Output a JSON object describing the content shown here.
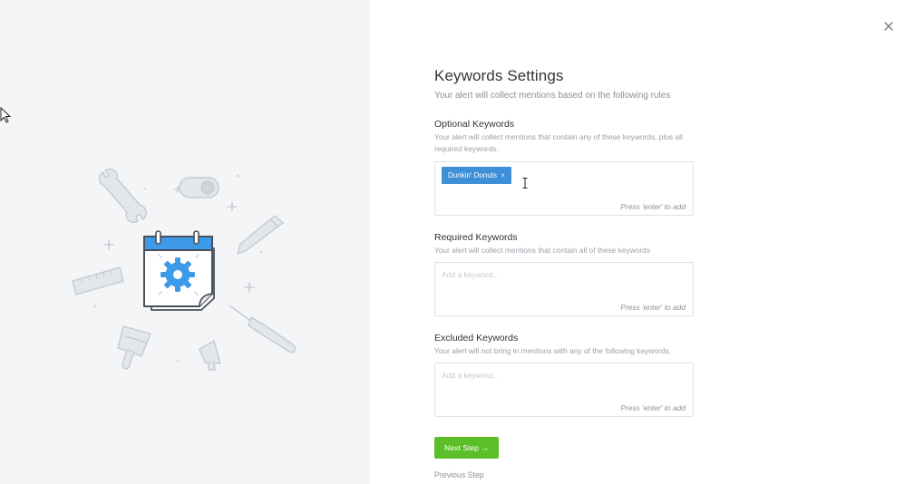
{
  "illustration": {
    "icons": [
      "calendar-gear-icon",
      "wrench-icon",
      "toggle-icon",
      "pencil-icon",
      "ruler-icon",
      "screwdriver-icon",
      "paintbrush-icon",
      "megaphone-icon"
    ],
    "accent_color": "#3d9ae8",
    "line_color": "#4a4f5c"
  },
  "dialog": {
    "close_icon": "close-icon",
    "title": "Keywords Settings",
    "subtitle": "Your alert will collect mentions based on the following rules"
  },
  "optional": {
    "title": "Optional Keywords",
    "desc": "Your alert will collect mentions that contain any of these keywords, plus all required keywords.",
    "tags": [
      {
        "label": "Dunkin' Donuts",
        "remove": "×"
      }
    ],
    "hint": "Press 'enter' to add"
  },
  "required": {
    "title": "Required Keywords",
    "desc": "Your alert will collect mentions that contain all of these keywords",
    "placeholder": "Add a keyword...",
    "hint": "Press 'enter' to add"
  },
  "excluded": {
    "title": "Excluded Keywords",
    "desc": "Your alert will not bring in mentions with any of the following keywords.",
    "placeholder": "Add a keyword...",
    "hint": "Press 'enter' to add"
  },
  "actions": {
    "next_label": "Next Step →",
    "next_color": "#5cbf2a",
    "prev_label": "Previous Step"
  }
}
